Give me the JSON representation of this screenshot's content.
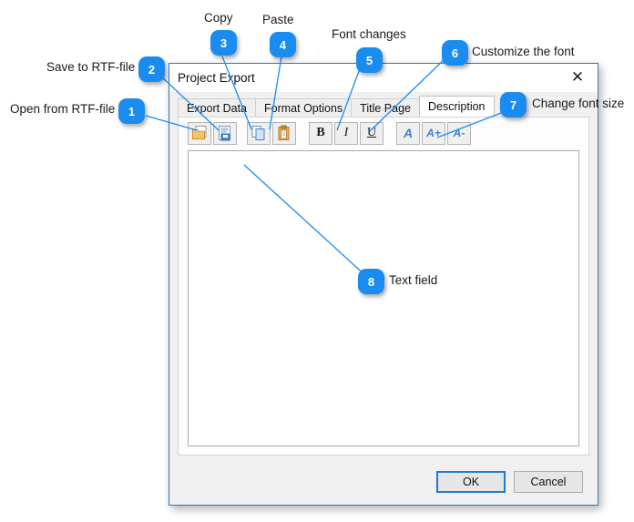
{
  "dialog": {
    "title": "Project Export",
    "close_icon": "close-icon",
    "tabs": [
      {
        "label": "Export Data",
        "active": false
      },
      {
        "label": "Format Options",
        "active": false
      },
      {
        "label": "Title Page",
        "active": false
      },
      {
        "label": "Description",
        "active": true
      }
    ],
    "toolbar": [
      {
        "name": "open-rtf-button",
        "icon": "open-folder-icon",
        "glyph": ""
      },
      {
        "name": "save-rtf-button",
        "icon": "save-disk-icon",
        "glyph": ""
      },
      {
        "name": "copy-button",
        "icon": "copy-pages-icon",
        "glyph": ""
      },
      {
        "name": "paste-button",
        "icon": "paste-clipboard-icon",
        "glyph": ""
      },
      {
        "name": "bold-button",
        "icon": "bold-icon",
        "glyph": "B"
      },
      {
        "name": "italic-button",
        "icon": "italic-icon",
        "glyph": "I"
      },
      {
        "name": "underline-button",
        "icon": "underline-icon",
        "glyph": "U"
      },
      {
        "name": "font-dialog-button",
        "icon": "font-A-icon",
        "glyph": "A"
      },
      {
        "name": "font-increase-button",
        "icon": "font-increase-icon",
        "glyph": "A+"
      },
      {
        "name": "font-decrease-button",
        "icon": "font-decrease-icon",
        "glyph": "A-"
      }
    ],
    "text_field_value": "",
    "buttons": {
      "ok": "OK",
      "cancel": "Cancel"
    }
  },
  "annotations": [
    {
      "number": "1",
      "label": "Open from RTF-file"
    },
    {
      "number": "2",
      "label": "Save to RTF-file"
    },
    {
      "number": "3",
      "label": "Copy"
    },
    {
      "number": "4",
      "label": "Paste"
    },
    {
      "number": "5",
      "label": "Font changes"
    },
    {
      "number": "6",
      "label": "Customize the font"
    },
    {
      "number": "7",
      "label": "Change font size"
    },
    {
      "number": "8",
      "label": "Text field"
    }
  ],
  "colors": {
    "accent": "#1a8cf0",
    "dialog_border": "#2b7bba",
    "default_button_border": "#1e7bd0",
    "dialog_background": "#f0f0f0",
    "toolbar_icon_blue": "#3f7fd0",
    "toolbar_icon_orange": "#e8a33d"
  }
}
